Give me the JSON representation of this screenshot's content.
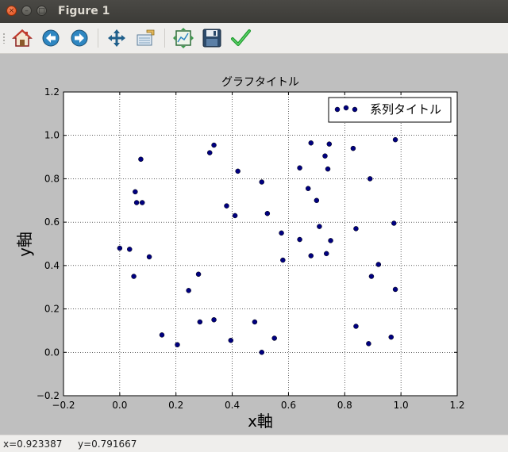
{
  "window": {
    "title": "Figure 1",
    "close_glyph": "×",
    "min_glyph": "–",
    "max_glyph": "□"
  },
  "toolbar": {
    "buttons": [
      {
        "name": "home-button",
        "icon": "home-icon"
      },
      {
        "name": "back-button",
        "icon": "back-arrow-icon"
      },
      {
        "name": "forward-button",
        "icon": "forward-arrow-icon"
      },
      {
        "name": "pan-button",
        "icon": "pan-move-icon"
      },
      {
        "name": "zoom-button",
        "icon": "zoom-rect-icon"
      },
      {
        "name": "subplots-button",
        "icon": "subplots-config-icon"
      },
      {
        "name": "save-button",
        "icon": "floppy-save-icon"
      },
      {
        "name": "edit-button",
        "icon": "checkmark-edit-icon"
      }
    ]
  },
  "status": {
    "x_readout": "x=0.923387",
    "y_readout": "y=0.791667"
  },
  "chart_data": {
    "type": "scatter",
    "title": "グラフタイトル",
    "xlabel": "x軸",
    "ylabel": "y軸",
    "xlim": [
      -0.2,
      1.2
    ],
    "ylim": [
      -0.2,
      1.2
    ],
    "xticks": [
      "−0.2",
      "0.0",
      "0.2",
      "0.4",
      "0.6",
      "0.8",
      "1.0",
      "1.2"
    ],
    "yticks": [
      "−0.2",
      "0.0",
      "0.2",
      "0.4",
      "0.6",
      "0.8",
      "1.0",
      "1.2"
    ],
    "grid": true,
    "legend_position": "top-right",
    "marker_color": "#000080",
    "series": [
      {
        "name": "系列タイトル",
        "points": [
          [
            0.0,
            0.48
          ],
          [
            0.035,
            0.475
          ],
          [
            0.05,
            0.35
          ],
          [
            0.105,
            0.44
          ],
          [
            0.055,
            0.74
          ],
          [
            0.06,
            0.69
          ],
          [
            0.08,
            0.69
          ],
          [
            0.075,
            0.89
          ],
          [
            0.15,
            0.08
          ],
          [
            0.205,
            0.035
          ],
          [
            0.245,
            0.285
          ],
          [
            0.28,
            0.36
          ],
          [
            0.285,
            0.14
          ],
          [
            0.32,
            0.92
          ],
          [
            0.335,
            0.955
          ],
          [
            0.335,
            0.15
          ],
          [
            0.38,
            0.675
          ],
          [
            0.395,
            0.055
          ],
          [
            0.41,
            0.63
          ],
          [
            0.42,
            0.835
          ],
          [
            0.48,
            0.14
          ],
          [
            0.505,
            0.785
          ],
          [
            0.505,
            0.0
          ],
          [
            0.525,
            0.64
          ],
          [
            0.55,
            0.065
          ],
          [
            0.575,
            0.55
          ],
          [
            0.58,
            0.425
          ],
          [
            0.64,
            0.85
          ],
          [
            0.64,
            0.52
          ],
          [
            0.67,
            0.755
          ],
          [
            0.68,
            0.965
          ],
          [
            0.68,
            0.445
          ],
          [
            0.7,
            0.7
          ],
          [
            0.71,
            0.58
          ],
          [
            0.73,
            0.905
          ],
          [
            0.735,
            0.455
          ],
          [
            0.74,
            0.845
          ],
          [
            0.745,
            0.96
          ],
          [
            0.75,
            0.515
          ],
          [
            0.83,
            0.94
          ],
          [
            0.84,
            0.57
          ],
          [
            0.84,
            0.12
          ],
          [
            0.885,
            0.04
          ],
          [
            0.89,
            0.8
          ],
          [
            0.895,
            0.35
          ],
          [
            0.92,
            0.405
          ],
          [
            0.965,
            0.07
          ],
          [
            0.975,
            0.595
          ],
          [
            0.98,
            0.98
          ],
          [
            0.98,
            0.29
          ]
        ]
      }
    ]
  }
}
